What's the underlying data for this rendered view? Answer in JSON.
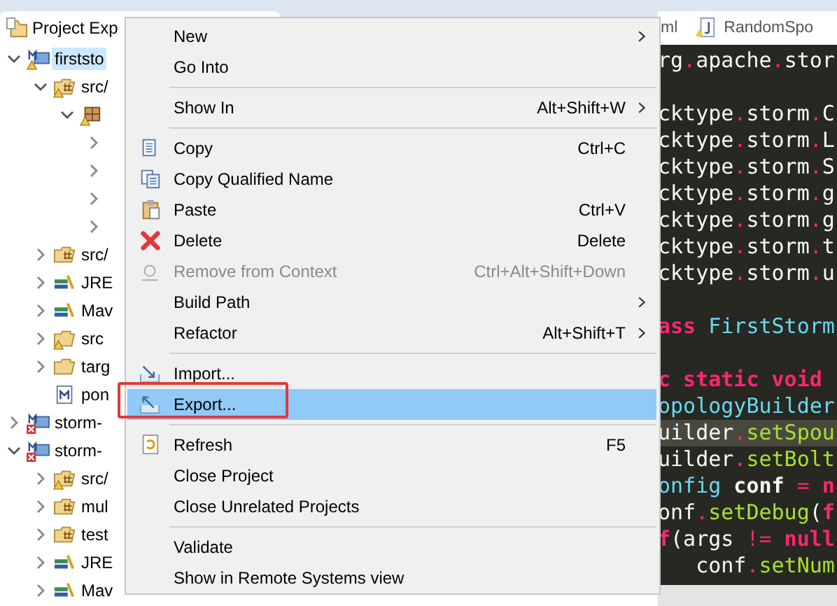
{
  "explorer": {
    "title": "Project Exp",
    "tree": [
      {
        "label": "firststo",
        "kind": "project",
        "warning": true,
        "error": false,
        "selected": true,
        "expanded": true,
        "children": [
          {
            "label": "src/",
            "kind": "source-folder",
            "warning": true,
            "error": false,
            "selected": false,
            "expanded": true,
            "children": [
              {
                "kind": "package",
                "warning": true,
                "error": false,
                "selected": false,
                "expanded": true,
                "children": [
                  {
                    "selected": false,
                    "expanded": false
                  },
                  {
                    "selected": false,
                    "expanded": false
                  },
                  {
                    "selected": false,
                    "expanded": false
                  },
                  {
                    "selected": false,
                    "expanded": false
                  }
                ]
              }
            ]
          },
          {
            "label": "src/",
            "kind": "source-folder",
            "warning": false,
            "error": false,
            "selected": false,
            "expanded": false
          },
          {
            "label": "JRE",
            "kind": "library",
            "warning": false,
            "error": false,
            "selected": false,
            "expanded": false
          },
          {
            "label": "Mav",
            "kind": "library",
            "warning": false,
            "error": false,
            "selected": false,
            "expanded": false
          },
          {
            "label": "src",
            "kind": "folder",
            "warning": true,
            "error": false,
            "selected": false,
            "expanded": false
          },
          {
            "label": "targ",
            "kind": "folder",
            "warning": false,
            "error": false,
            "selected": false,
            "expanded": false
          },
          {
            "label": "pon",
            "kind": "maven-file",
            "warning": false,
            "error": false,
            "selected": false
          }
        ]
      },
      {
        "label": "storm-",
        "kind": "project",
        "warning": false,
        "error": true,
        "selected": false,
        "expanded": false
      },
      {
        "label": "storm-",
        "kind": "project",
        "warning": false,
        "error": true,
        "selected": false,
        "expanded": true,
        "children": [
          {
            "label": "src/",
            "kind": "source-folder",
            "warning": true,
            "error": false,
            "selected": false,
            "expanded": false
          },
          {
            "label": "mul",
            "kind": "source-folder",
            "warning": false,
            "error": false,
            "selected": false,
            "expanded": false
          },
          {
            "label": "test",
            "kind": "source-folder",
            "warning": false,
            "error": false,
            "selected": false,
            "expanded": false
          },
          {
            "label": "JRE",
            "kind": "library",
            "warning": false,
            "error": false,
            "selected": false,
            "expanded": false
          },
          {
            "label": "Mav",
            "kind": "library",
            "warning": false,
            "error": false,
            "selected": false,
            "expanded": false
          }
        ]
      }
    ]
  },
  "editor": {
    "tabs": [
      {
        "label": "ml",
        "selected": false
      },
      {
        "label": "RandomSpo",
        "selected": false
      }
    ],
    "lines": [
      {
        "current": false,
        "tokens": [
          {
            "t": "rg",
            "kind": "plain"
          },
          {
            "t": ".",
            "kind": "op"
          },
          {
            "t": "apache",
            "kind": "plain"
          },
          {
            "t": ".",
            "kind": "op"
          },
          {
            "t": "stor",
            "kind": "plain"
          }
        ]
      },
      {
        "current": false
      },
      {
        "current": false,
        "tokens": [
          {
            "t": "cktype",
            "kind": "plain"
          },
          {
            "t": ".",
            "kind": "op"
          },
          {
            "t": "storm",
            "kind": "plain"
          },
          {
            "t": ".",
            "kind": "op"
          },
          {
            "t": "C",
            "kind": "plain"
          }
        ]
      },
      {
        "current": false,
        "tokens": [
          {
            "t": "cktype",
            "kind": "plain"
          },
          {
            "t": ".",
            "kind": "op"
          },
          {
            "t": "storm",
            "kind": "plain"
          },
          {
            "t": ".",
            "kind": "op"
          },
          {
            "t": "L",
            "kind": "plain"
          }
        ]
      },
      {
        "current": false,
        "tokens": [
          {
            "t": "cktype",
            "kind": "plain"
          },
          {
            "t": ".",
            "kind": "op"
          },
          {
            "t": "storm",
            "kind": "plain"
          },
          {
            "t": ".",
            "kind": "op"
          },
          {
            "t": "S",
            "kind": "plain"
          }
        ]
      },
      {
        "current": false,
        "tokens": [
          {
            "t": "cktype",
            "kind": "plain"
          },
          {
            "t": ".",
            "kind": "op"
          },
          {
            "t": "storm",
            "kind": "plain"
          },
          {
            "t": ".",
            "kind": "op"
          },
          {
            "t": "g",
            "kind": "plain"
          }
        ]
      },
      {
        "current": false,
        "tokens": [
          {
            "t": "cktype",
            "kind": "plain"
          },
          {
            "t": ".",
            "kind": "op"
          },
          {
            "t": "storm",
            "kind": "plain"
          },
          {
            "t": ".",
            "kind": "op"
          },
          {
            "t": "g",
            "kind": "plain"
          }
        ]
      },
      {
        "current": false,
        "tokens": [
          {
            "t": "cktype",
            "kind": "plain"
          },
          {
            "t": ".",
            "kind": "op"
          },
          {
            "t": "storm",
            "kind": "plain"
          },
          {
            "t": ".",
            "kind": "op"
          },
          {
            "t": "t",
            "kind": "plain"
          }
        ]
      },
      {
        "current": false,
        "tokens": [
          {
            "t": "cktype",
            "kind": "plain"
          },
          {
            "t": ".",
            "kind": "op"
          },
          {
            "t": "storm",
            "kind": "plain"
          },
          {
            "t": ".",
            "kind": "op"
          },
          {
            "t": "u",
            "kind": "plain"
          }
        ]
      },
      {
        "current": false
      },
      {
        "current": false,
        "tokens": [
          {
            "t": "ass",
            "kind": "keyword"
          },
          {
            "t": " FirstStorm",
            "kind": "type"
          }
        ]
      },
      {
        "current": false
      },
      {
        "current": false,
        "tokens": [
          {
            "t": "c static void",
            "kind": "keyword"
          }
        ]
      },
      {
        "current": false,
        "tokens": [
          {
            "t": "opologyBuilder",
            "kind": "type"
          }
        ]
      },
      {
        "current": true,
        "tokens": [
          {
            "t": "uilder",
            "kind": "plain"
          },
          {
            "t": ".",
            "kind": "op"
          },
          {
            "t": "setSpou",
            "kind": "method"
          }
        ]
      },
      {
        "current": false,
        "tokens": [
          {
            "t": "uilder",
            "kind": "plain"
          },
          {
            "t": ".",
            "kind": "op"
          },
          {
            "t": "setBolt",
            "kind": "method"
          }
        ]
      },
      {
        "current": false,
        "tokens": [
          {
            "t": "onfig",
            "kind": "type"
          },
          {
            "t": " conf",
            "kind": "bold"
          },
          {
            "t": " = ",
            "kind": "op"
          },
          {
            "t": "n",
            "kind": "keyword"
          }
        ]
      },
      {
        "current": false,
        "tokens": [
          {
            "t": "onf",
            "kind": "plain"
          },
          {
            "t": ".",
            "kind": "op"
          },
          {
            "t": "setDebug",
            "kind": "method"
          },
          {
            "t": "(",
            "kind": "plain"
          },
          {
            "t": "f",
            "kind": "keyword"
          }
        ]
      },
      {
        "current": false,
        "tokens": [
          {
            "t": "f",
            "kind": "keyword"
          },
          {
            "t": "(args ",
            "kind": "plain"
          },
          {
            "t": "!=",
            "kind": "op"
          },
          {
            "t": " null",
            "kind": "keyword"
          }
        ]
      },
      {
        "current": false,
        "tokens": [
          {
            "t": "   conf",
            "kind": "plain"
          },
          {
            "t": ".",
            "kind": "op"
          },
          {
            "t": "setNum",
            "kind": "method"
          }
        ]
      }
    ]
  },
  "context_menu": {
    "items": [
      {
        "kind": "item",
        "label": "New",
        "submenu": true,
        "disabled": false,
        "selected": false
      },
      {
        "kind": "item",
        "label": "Go Into",
        "submenu": false,
        "disabled": false,
        "selected": false
      },
      {
        "kind": "separator"
      },
      {
        "kind": "item",
        "label": "Show In",
        "shortcut": "Alt+Shift+W",
        "submenu": true,
        "disabled": false,
        "selected": false
      },
      {
        "kind": "separator"
      },
      {
        "kind": "item",
        "label": "Copy",
        "shortcut": "Ctrl+C",
        "submenu": false,
        "disabled": false,
        "selected": false
      },
      {
        "kind": "item",
        "label": "Copy Qualified Name",
        "submenu": false,
        "disabled": false,
        "selected": false
      },
      {
        "kind": "item",
        "label": "Paste",
        "shortcut": "Ctrl+V",
        "submenu": false,
        "disabled": false,
        "selected": false
      },
      {
        "kind": "item",
        "label": "Delete",
        "shortcut": "Delete",
        "submenu": false,
        "disabled": false,
        "selected": false
      },
      {
        "kind": "item",
        "label": "Remove from Context",
        "shortcut": "Ctrl+Alt+Shift+Down",
        "submenu": false,
        "disabled": true,
        "selected": false
      },
      {
        "kind": "item",
        "label": "Build Path",
        "submenu": true,
        "disabled": false,
        "selected": false
      },
      {
        "kind": "item",
        "label": "Refactor",
        "shortcut": "Alt+Shift+T",
        "submenu": true,
        "disabled": false,
        "selected": false
      },
      {
        "kind": "separator"
      },
      {
        "kind": "item",
        "label": "Import...",
        "submenu": false,
        "disabled": false,
        "selected": false
      },
      {
        "kind": "item",
        "label": "Export...",
        "submenu": false,
        "disabled": false,
        "selected": true,
        "outlined": true
      },
      {
        "kind": "separator"
      },
      {
        "kind": "item",
        "label": "Refresh",
        "shortcut": "F5",
        "submenu": false,
        "disabled": false,
        "selected": false
      },
      {
        "kind": "item",
        "label": "Close Project",
        "submenu": false,
        "disabled": false,
        "selected": false
      },
      {
        "kind": "item",
        "label": "Close Unrelated Projects",
        "submenu": false,
        "disabled": false,
        "selected": false
      },
      {
        "kind": "separator"
      },
      {
        "kind": "item",
        "label": "Validate",
        "submenu": false,
        "disabled": false,
        "selected": false
      },
      {
        "kind": "item",
        "label": "Show in Remote Systems view",
        "submenu": false,
        "disabled": false,
        "selected": false
      }
    ]
  }
}
